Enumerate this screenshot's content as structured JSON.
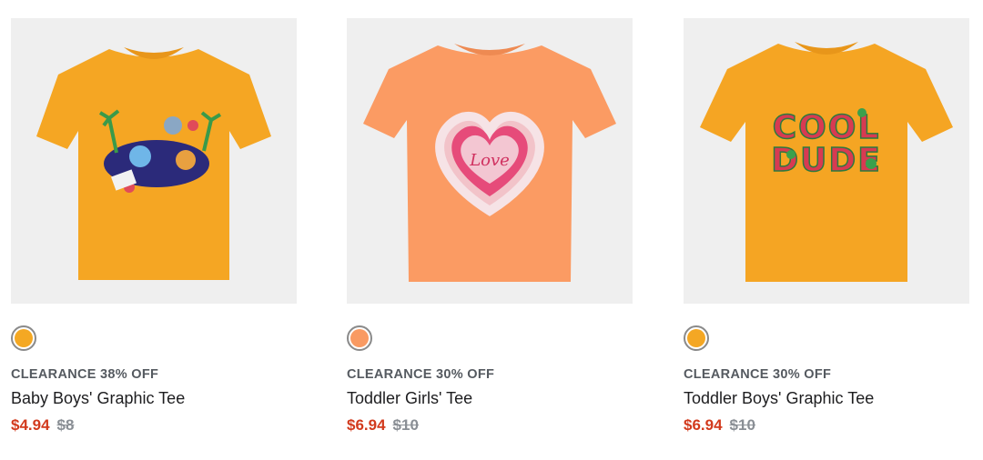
{
  "products": [
    {
      "badge": "CLEARANCE 38% OFF",
      "name": "Baby Boys' Graphic Tee",
      "sale_price": "$4.94",
      "original_price": "$8",
      "shirt_color": "#f5a623",
      "swatch_color": "#f4a823"
    },
    {
      "badge": "CLEARANCE 30% OFF",
      "name": "Toddler Girls' Tee",
      "sale_price": "$6.94",
      "original_price": "$10",
      "shirt_color": "#fb9b63",
      "swatch_color": "#f99a62",
      "graphic_text": "Love"
    },
    {
      "badge": "CLEARANCE 30% OFF",
      "name": "Toddler Boys' Graphic Tee",
      "sale_price": "$6.94",
      "original_price": "$10",
      "shirt_color": "#f5a523",
      "swatch_color": "#f4a724",
      "graphic_text_1": "COOL",
      "graphic_text_2": "DUDE"
    }
  ]
}
